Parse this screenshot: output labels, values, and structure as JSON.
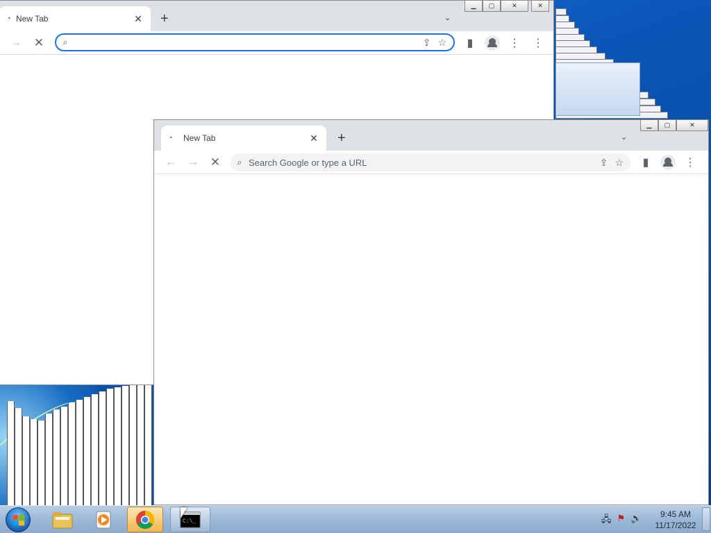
{
  "back_window": {
    "tab": {
      "title": "New Tab"
    },
    "omnibox": {
      "value": "",
      "placeholder": ""
    },
    "icons": {
      "forward": "arrow-right-icon",
      "stop": "close-icon",
      "search": "search-icon",
      "share": "share-icon",
      "bookmark": "star-icon",
      "side_panel": "side-panel-icon",
      "profile": "profile-icon",
      "menu": "kebab-menu-icon"
    }
  },
  "front_window": {
    "tab": {
      "title": "New Tab"
    },
    "omnibox": {
      "value": "",
      "placeholder": "Search Google or type a URL"
    },
    "icons": {
      "back": "arrow-left-icon",
      "forward": "arrow-right-icon",
      "stop": "close-icon",
      "search": "search-icon",
      "share": "share-icon",
      "bookmark": "star-icon",
      "side_panel": "side-panel-icon",
      "profile": "profile-icon",
      "menu": "kebab-menu-icon"
    }
  },
  "taskbar": {
    "apps": [
      {
        "name": "Windows Explorer",
        "icon": "folder-icon",
        "state": "pinned"
      },
      {
        "name": "Windows Media Player",
        "icon": "media-player-icon",
        "state": "pinned"
      },
      {
        "name": "Google Chrome",
        "icon": "chrome-icon",
        "state": "active"
      },
      {
        "name": "Command Prompt",
        "icon": "terminal-icon",
        "state": "open"
      }
    ],
    "clock": {
      "time": "9:45 AM",
      "date": "11/17/2022"
    }
  },
  "colors": {
    "accent": "#1a73e8",
    "titlebar": "#dee1e6",
    "desktop": "#0b4fa8",
    "taskbar": "#9eb9d8"
  }
}
